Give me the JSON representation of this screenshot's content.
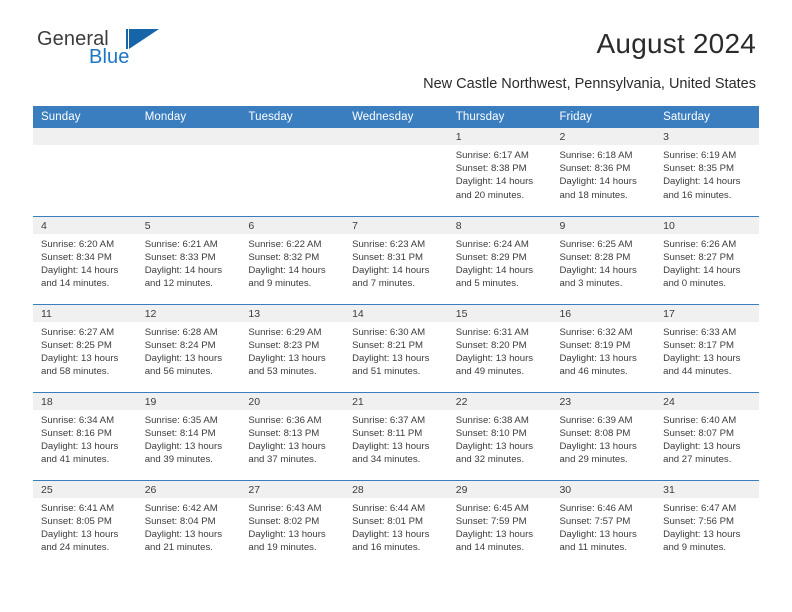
{
  "brand": {
    "name_part1": "General",
    "name_part2": "Blue",
    "accent_color": "#1d76c3",
    "triangle_color": "#1565a8"
  },
  "header": {
    "title": "August 2024",
    "subtitle": "New Castle Northwest, Pennsylvania, United States",
    "header_bg_color": "#3a7ebf",
    "daynum_bg_color": "#f0f0f0"
  },
  "calendar": {
    "weekday_headers": [
      "Sunday",
      "Monday",
      "Tuesday",
      "Wednesday",
      "Thursday",
      "Friday",
      "Saturday"
    ],
    "weeks": [
      [
        {
          "day": "",
          "blank": true
        },
        {
          "day": "",
          "blank": true
        },
        {
          "day": "",
          "blank": true
        },
        {
          "day": "",
          "blank": true
        },
        {
          "day": "1",
          "sunrise": "Sunrise: 6:17 AM",
          "sunset": "Sunset: 8:38 PM",
          "daylight_line1": "Daylight: 14 hours",
          "daylight_line2": "and 20 minutes."
        },
        {
          "day": "2",
          "sunrise": "Sunrise: 6:18 AM",
          "sunset": "Sunset: 8:36 PM",
          "daylight_line1": "Daylight: 14 hours",
          "daylight_line2": "and 18 minutes."
        },
        {
          "day": "3",
          "sunrise": "Sunrise: 6:19 AM",
          "sunset": "Sunset: 8:35 PM",
          "daylight_line1": "Daylight: 14 hours",
          "daylight_line2": "and 16 minutes."
        }
      ],
      [
        {
          "day": "4",
          "sunrise": "Sunrise: 6:20 AM",
          "sunset": "Sunset: 8:34 PM",
          "daylight_line1": "Daylight: 14 hours",
          "daylight_line2": "and 14 minutes."
        },
        {
          "day": "5",
          "sunrise": "Sunrise: 6:21 AM",
          "sunset": "Sunset: 8:33 PM",
          "daylight_line1": "Daylight: 14 hours",
          "daylight_line2": "and 12 minutes."
        },
        {
          "day": "6",
          "sunrise": "Sunrise: 6:22 AM",
          "sunset": "Sunset: 8:32 PM",
          "daylight_line1": "Daylight: 14 hours",
          "daylight_line2": "and 9 minutes."
        },
        {
          "day": "7",
          "sunrise": "Sunrise: 6:23 AM",
          "sunset": "Sunset: 8:31 PM",
          "daylight_line1": "Daylight: 14 hours",
          "daylight_line2": "and 7 minutes."
        },
        {
          "day": "8",
          "sunrise": "Sunrise: 6:24 AM",
          "sunset": "Sunset: 8:29 PM",
          "daylight_line1": "Daylight: 14 hours",
          "daylight_line2": "and 5 minutes."
        },
        {
          "day": "9",
          "sunrise": "Sunrise: 6:25 AM",
          "sunset": "Sunset: 8:28 PM",
          "daylight_line1": "Daylight: 14 hours",
          "daylight_line2": "and 3 minutes."
        },
        {
          "day": "10",
          "sunrise": "Sunrise: 6:26 AM",
          "sunset": "Sunset: 8:27 PM",
          "daylight_line1": "Daylight: 14 hours",
          "daylight_line2": "and 0 minutes."
        }
      ],
      [
        {
          "day": "11",
          "sunrise": "Sunrise: 6:27 AM",
          "sunset": "Sunset: 8:25 PM",
          "daylight_line1": "Daylight: 13 hours",
          "daylight_line2": "and 58 minutes."
        },
        {
          "day": "12",
          "sunrise": "Sunrise: 6:28 AM",
          "sunset": "Sunset: 8:24 PM",
          "daylight_line1": "Daylight: 13 hours",
          "daylight_line2": "and 56 minutes."
        },
        {
          "day": "13",
          "sunrise": "Sunrise: 6:29 AM",
          "sunset": "Sunset: 8:23 PM",
          "daylight_line1": "Daylight: 13 hours",
          "daylight_line2": "and 53 minutes."
        },
        {
          "day": "14",
          "sunrise": "Sunrise: 6:30 AM",
          "sunset": "Sunset: 8:21 PM",
          "daylight_line1": "Daylight: 13 hours",
          "daylight_line2": "and 51 minutes."
        },
        {
          "day": "15",
          "sunrise": "Sunrise: 6:31 AM",
          "sunset": "Sunset: 8:20 PM",
          "daylight_line1": "Daylight: 13 hours",
          "daylight_line2": "and 49 minutes."
        },
        {
          "day": "16",
          "sunrise": "Sunrise: 6:32 AM",
          "sunset": "Sunset: 8:19 PM",
          "daylight_line1": "Daylight: 13 hours",
          "daylight_line2": "and 46 minutes."
        },
        {
          "day": "17",
          "sunrise": "Sunrise: 6:33 AM",
          "sunset": "Sunset: 8:17 PM",
          "daylight_line1": "Daylight: 13 hours",
          "daylight_line2": "and 44 minutes."
        }
      ],
      [
        {
          "day": "18",
          "sunrise": "Sunrise: 6:34 AM",
          "sunset": "Sunset: 8:16 PM",
          "daylight_line1": "Daylight: 13 hours",
          "daylight_line2": "and 41 minutes."
        },
        {
          "day": "19",
          "sunrise": "Sunrise: 6:35 AM",
          "sunset": "Sunset: 8:14 PM",
          "daylight_line1": "Daylight: 13 hours",
          "daylight_line2": "and 39 minutes."
        },
        {
          "day": "20",
          "sunrise": "Sunrise: 6:36 AM",
          "sunset": "Sunset: 8:13 PM",
          "daylight_line1": "Daylight: 13 hours",
          "daylight_line2": "and 37 minutes."
        },
        {
          "day": "21",
          "sunrise": "Sunrise: 6:37 AM",
          "sunset": "Sunset: 8:11 PM",
          "daylight_line1": "Daylight: 13 hours",
          "daylight_line2": "and 34 minutes."
        },
        {
          "day": "22",
          "sunrise": "Sunrise: 6:38 AM",
          "sunset": "Sunset: 8:10 PM",
          "daylight_line1": "Daylight: 13 hours",
          "daylight_line2": "and 32 minutes."
        },
        {
          "day": "23",
          "sunrise": "Sunrise: 6:39 AM",
          "sunset": "Sunset: 8:08 PM",
          "daylight_line1": "Daylight: 13 hours",
          "daylight_line2": "and 29 minutes."
        },
        {
          "day": "24",
          "sunrise": "Sunrise: 6:40 AM",
          "sunset": "Sunset: 8:07 PM",
          "daylight_line1": "Daylight: 13 hours",
          "daylight_line2": "and 27 minutes."
        }
      ],
      [
        {
          "day": "25",
          "sunrise": "Sunrise: 6:41 AM",
          "sunset": "Sunset: 8:05 PM",
          "daylight_line1": "Daylight: 13 hours",
          "daylight_line2": "and 24 minutes."
        },
        {
          "day": "26",
          "sunrise": "Sunrise: 6:42 AM",
          "sunset": "Sunset: 8:04 PM",
          "daylight_line1": "Daylight: 13 hours",
          "daylight_line2": "and 21 minutes."
        },
        {
          "day": "27",
          "sunrise": "Sunrise: 6:43 AM",
          "sunset": "Sunset: 8:02 PM",
          "daylight_line1": "Daylight: 13 hours",
          "daylight_line2": "and 19 minutes."
        },
        {
          "day": "28",
          "sunrise": "Sunrise: 6:44 AM",
          "sunset": "Sunset: 8:01 PM",
          "daylight_line1": "Daylight: 13 hours",
          "daylight_line2": "and 16 minutes."
        },
        {
          "day": "29",
          "sunrise": "Sunrise: 6:45 AM",
          "sunset": "Sunset: 7:59 PM",
          "daylight_line1": "Daylight: 13 hours",
          "daylight_line2": "and 14 minutes."
        },
        {
          "day": "30",
          "sunrise": "Sunrise: 6:46 AM",
          "sunset": "Sunset: 7:57 PM",
          "daylight_line1": "Daylight: 13 hours",
          "daylight_line2": "and 11 minutes."
        },
        {
          "day": "31",
          "sunrise": "Sunrise: 6:47 AM",
          "sunset": "Sunset: 7:56 PM",
          "daylight_line1": "Daylight: 13 hours",
          "daylight_line2": "and 9 minutes."
        }
      ]
    ]
  }
}
